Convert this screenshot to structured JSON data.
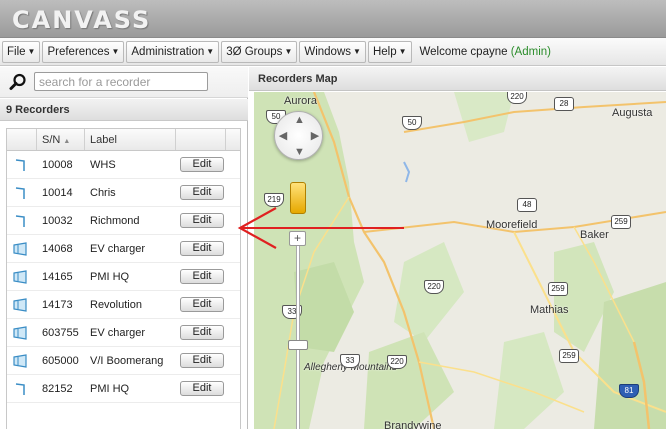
{
  "app": {
    "logo": "CANVASS"
  },
  "menu": {
    "items": [
      {
        "label": "File"
      },
      {
        "label": "Preferences"
      },
      {
        "label": "Administration"
      },
      {
        "label": "3Ø Groups"
      },
      {
        "label": "Windows"
      },
      {
        "label": "Help"
      }
    ],
    "welcome_text": "Welcome cpayne",
    "welcome_role": "(Admin)"
  },
  "search": {
    "placeholder": "search for a recorder"
  },
  "recorders": {
    "count_label": "9 Recorders",
    "columns": {
      "sn": "S/N",
      "label": "Label"
    },
    "edit_label": "Edit",
    "rows": [
      {
        "sn": "10008",
        "label": "WHS",
        "icon": "single-recorder-icon"
      },
      {
        "sn": "10014",
        "label": "Chris",
        "icon": "single-recorder-icon"
      },
      {
        "sn": "10032",
        "label": "Richmond",
        "icon": "single-recorder-icon"
      },
      {
        "sn": "14068",
        "label": "EV charger",
        "icon": "group-recorder-icon"
      },
      {
        "sn": "14165",
        "label": "PMI HQ",
        "icon": "group-recorder-icon"
      },
      {
        "sn": "14173",
        "label": "Revolution",
        "icon": "group-recorder-icon"
      },
      {
        "sn": "603755",
        "label": "EV charger",
        "icon": "group-recorder-icon"
      },
      {
        "sn": "605000",
        "label": "V/I Boomerang",
        "icon": "group-recorder-icon"
      },
      {
        "sn": "82152",
        "label": "PMI HQ",
        "icon": "single-recorder-icon"
      }
    ]
  },
  "map": {
    "title": "Recorders Map",
    "towns": {
      "aurora": "Aurora",
      "augusta": "Augusta",
      "moorefield": "Moorefield",
      "baker": "Baker",
      "mathias": "Mathias",
      "allegheny": "Allegheny Mountains",
      "brandywine": "Brandywine"
    },
    "shields": {
      "s220a": "220",
      "s28": "28",
      "s50a": "50",
      "s50b": "50",
      "s219": "219",
      "s48": "48",
      "s259a": "259",
      "s259b": "259",
      "s259c": "259",
      "s220b": "220",
      "s220c": "220",
      "s33a": "33",
      "s33b": "33",
      "s81": "81"
    },
    "zoom_in": "+",
    "zoom_out": "−"
  },
  "colors": {
    "accent_green": "#2a8c2a",
    "annotation_red": "#e02020",
    "map_forest": "#cde3b4",
    "map_road": "#f5c36a"
  }
}
